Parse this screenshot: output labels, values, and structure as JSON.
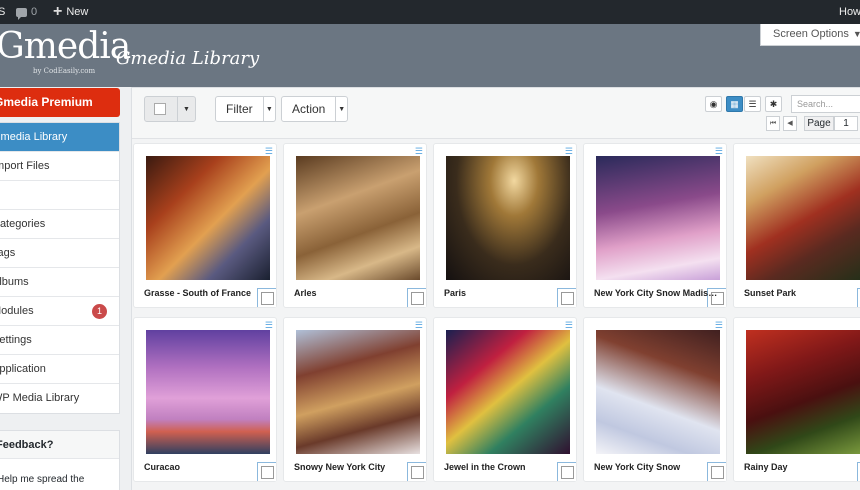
{
  "adminbar": {
    "site_fragment": "S",
    "comments_count": "0",
    "new_label": "New",
    "howdy": "How"
  },
  "header": {
    "logo_text": "Gmedia",
    "logo_sub": "by CodEasily.com",
    "page_title": "Gmedia Library",
    "screen_options": "Screen Options"
  },
  "sidebar": {
    "premium": "Gmedia Premium",
    "items": [
      {
        "label": "Gmedia Library",
        "active": true
      },
      {
        "label": "Import Files"
      },
      {
        "label": ""
      },
      {
        "label": "Categories"
      },
      {
        "label": "Tags"
      },
      {
        "label": "Albums"
      },
      {
        "label": "Modules",
        "badge": "1"
      },
      {
        "label": "Settings"
      },
      {
        "label": "Application"
      },
      {
        "label": "WP Media Library"
      }
    ],
    "feedback_title": "Feedback?",
    "feedback_text": "Help me spread the"
  },
  "toolbar": {
    "filter": "Filter",
    "action": "Action",
    "search_placeholder": "Search...",
    "page_label": "Page",
    "page_number": "1"
  },
  "items": [
    {
      "caption": "Grasse - South of France",
      "gradient": "linear-gradient(135deg,#3a1a10 0%,#a8401c 30%,#e2a050 55%,#5a5a80 75%,#1a2030 100%)"
    },
    {
      "caption": "Arles",
      "gradient": "linear-gradient(160deg,#5a3b20 0%,#c9a070 35%,#8a6238 60%,#d8b888 80%,#6a4a2c 100%)"
    },
    {
      "caption": "Paris",
      "gradient": "radial-gradient(ellipse at 55% 20%,#f2d8a0 0%,#a07838 25%,#3a2c1c 60%,#141010 100%)"
    },
    {
      "caption": "New York City Snow Madis…",
      "gradient": "linear-gradient(170deg,#2a2a5a 0%,#8a4a8a 40%,#e0a0c8 65%,#f4e0f0 85%,#c8a0d8 100%)"
    },
    {
      "caption": "Sunset Park",
      "gradient": "linear-gradient(150deg,#f0e0c0 0%,#d0a060 25%,#a03020 50%,#5a2a20 70%,#203018 100%)"
    },
    {
      "caption": "Curacao",
      "gradient": "linear-gradient(180deg,#6040a0 0%,#b070c0 30%,#e0a0d8 55%,#c080c0 72%,#d06050 82%,#304060 100%)"
    },
    {
      "caption": "Snowy New York City",
      "gradient": "linear-gradient(165deg,#b0c0d8 0%,#804030 30%,#d0a060 55%,#6a3a2a 75%,#e8e0e0 100%)"
    },
    {
      "caption": "Jewel in the Crown",
      "gradient": "linear-gradient(140deg,#1a2050 0%,#c02040 30%,#e0c040 50%,#308060 70%,#301030 100%)"
    },
    {
      "caption": "New York City Snow",
      "gradient": "linear-gradient(200deg,#402020 0%,#804030 30%,#e0e4f0 60%,#c0c8e0 80%,#f4f4f8 100%)"
    },
    {
      "caption": "Rainy Day",
      "gradient": "linear-gradient(160deg,#c03020 0%,#801818 30%,#4a1010 55%,#304818 75%,#80a040 100%)"
    }
  ]
}
